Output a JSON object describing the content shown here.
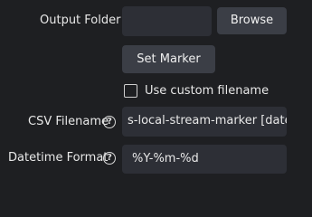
{
  "output_folder": {
    "label": "Output Folder",
    "value": "",
    "browse_label": "Browse"
  },
  "marker": {
    "set_marker_label": "Set Marker"
  },
  "custom_filename": {
    "checkbox_label": "Use custom filename",
    "checked": false
  },
  "csv_filename": {
    "label": "CSV Filename",
    "value": "s-local-stream-marker [date]",
    "help_icon": "question-circle-icon"
  },
  "datetime_format": {
    "label": "Datetime Format",
    "value": "%Y-%m-%d",
    "help_icon": "question-circle-icon"
  },
  "colors": {
    "background": "#1e1f22",
    "field_bg": "#2d2f36",
    "button_bg": "#3b3e46",
    "text": "#e8e8e8"
  }
}
